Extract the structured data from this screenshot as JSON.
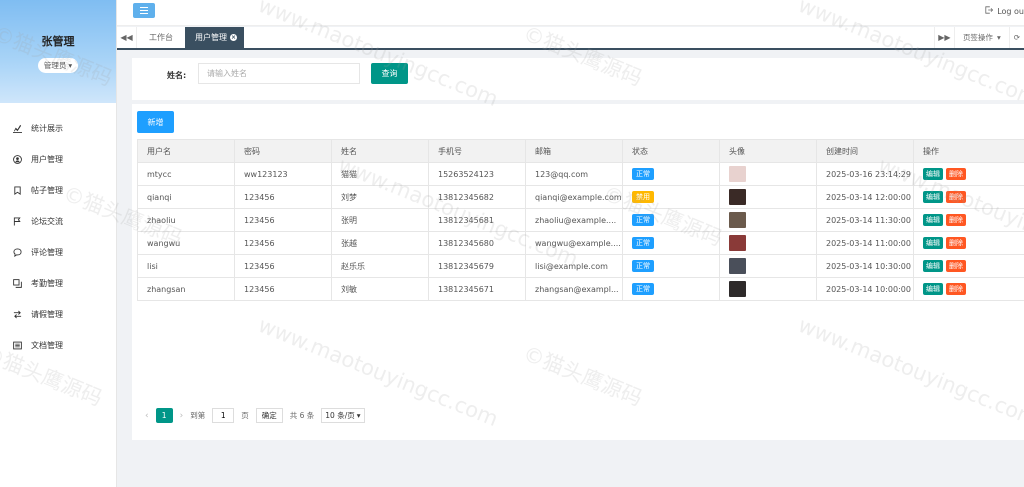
{
  "sidebar": {
    "user_name": "张管理",
    "role": "管理员",
    "items": [
      {
        "label": "统计展示",
        "icon": "chart-icon"
      },
      {
        "label": "用户管理",
        "icon": "user-icon"
      },
      {
        "label": "帖子管理",
        "icon": "bookmark-icon"
      },
      {
        "label": "论坛交流",
        "icon": "flag-icon"
      },
      {
        "label": "评论管理",
        "icon": "comment-icon"
      },
      {
        "label": "考勤管理",
        "icon": "copy-icon"
      },
      {
        "label": "请假管理",
        "icon": "exchange-icon"
      },
      {
        "label": "文档管理",
        "icon": "document-icon"
      }
    ]
  },
  "topbar": {
    "logout_label": "Log ou"
  },
  "tabs": {
    "items": [
      {
        "label": "工作台"
      },
      {
        "label": "用户管理"
      }
    ],
    "page_ops_label": "页签操作"
  },
  "search": {
    "label": "姓名:",
    "placeholder": "请输入姓名",
    "button_label": "查询"
  },
  "toolbar": {
    "add_label": "新增"
  },
  "table": {
    "columns": [
      "用户名",
      "密码",
      "姓名",
      "手机号",
      "邮箱",
      "状态",
      "头像",
      "创建时间",
      "操作"
    ],
    "rows": [
      {
        "username": "mtycc",
        "password": "ww123123",
        "name": "猫猫",
        "phone": "15263524123",
        "email": "123@qq.com",
        "status": "正常",
        "status_type": "normal",
        "avatar_color": "#e8d2cf",
        "created": "2025-03-16 23:14:29"
      },
      {
        "username": "qianqi",
        "password": "123456",
        "name": "刘梦",
        "phone": "13812345682",
        "email": "qianqi@example.com",
        "status": "禁用",
        "status_type": "disabled",
        "avatar_color": "#3a2a26",
        "created": "2025-03-14 12:00:00"
      },
      {
        "username": "zhaoliu",
        "password": "123456",
        "name": "张明",
        "phone": "13812345681",
        "email": "zhaoliu@example....",
        "status": "正常",
        "status_type": "normal",
        "avatar_color": "#6b5a4c",
        "created": "2025-03-14 11:30:00"
      },
      {
        "username": "wangwu",
        "password": "123456",
        "name": "张越",
        "phone": "13812345680",
        "email": "wangwu@example....",
        "status": "正常",
        "status_type": "normal",
        "avatar_color": "#8a3a38",
        "created": "2025-03-14 11:00:00"
      },
      {
        "username": "lisi",
        "password": "123456",
        "name": "赵乐乐",
        "phone": "13812345679",
        "email": "lisi@example.com",
        "status": "正常",
        "status_type": "normal",
        "avatar_color": "#4a4f5a",
        "created": "2025-03-14 10:30:00"
      },
      {
        "username": "zhangsan",
        "password": "123456",
        "name": "刘敏",
        "phone": "13812345671",
        "email": "zhangsan@exampl...",
        "status": "正常",
        "status_type": "normal",
        "avatar_color": "#2e2a2a",
        "created": "2025-03-14 10:00:00"
      }
    ],
    "edit_label": "编辑",
    "delete_label": "删除"
  },
  "pager": {
    "current_page": "1",
    "goto_label": "到第",
    "goto_value": "1",
    "page_unit": "页",
    "confirm_label": "确定",
    "total_label": "共 6 条",
    "page_size": "10 条/页"
  },
  "watermark": {
    "text_a": "©猫头鹰源码",
    "text_b": "www.maotouyingcc.com"
  },
  "colors": {
    "primary": "#009688",
    "blue": "#1e9fff",
    "warn": "#ffb800",
    "danger": "#ff5722",
    "tab_active": "#3a4f60"
  }
}
